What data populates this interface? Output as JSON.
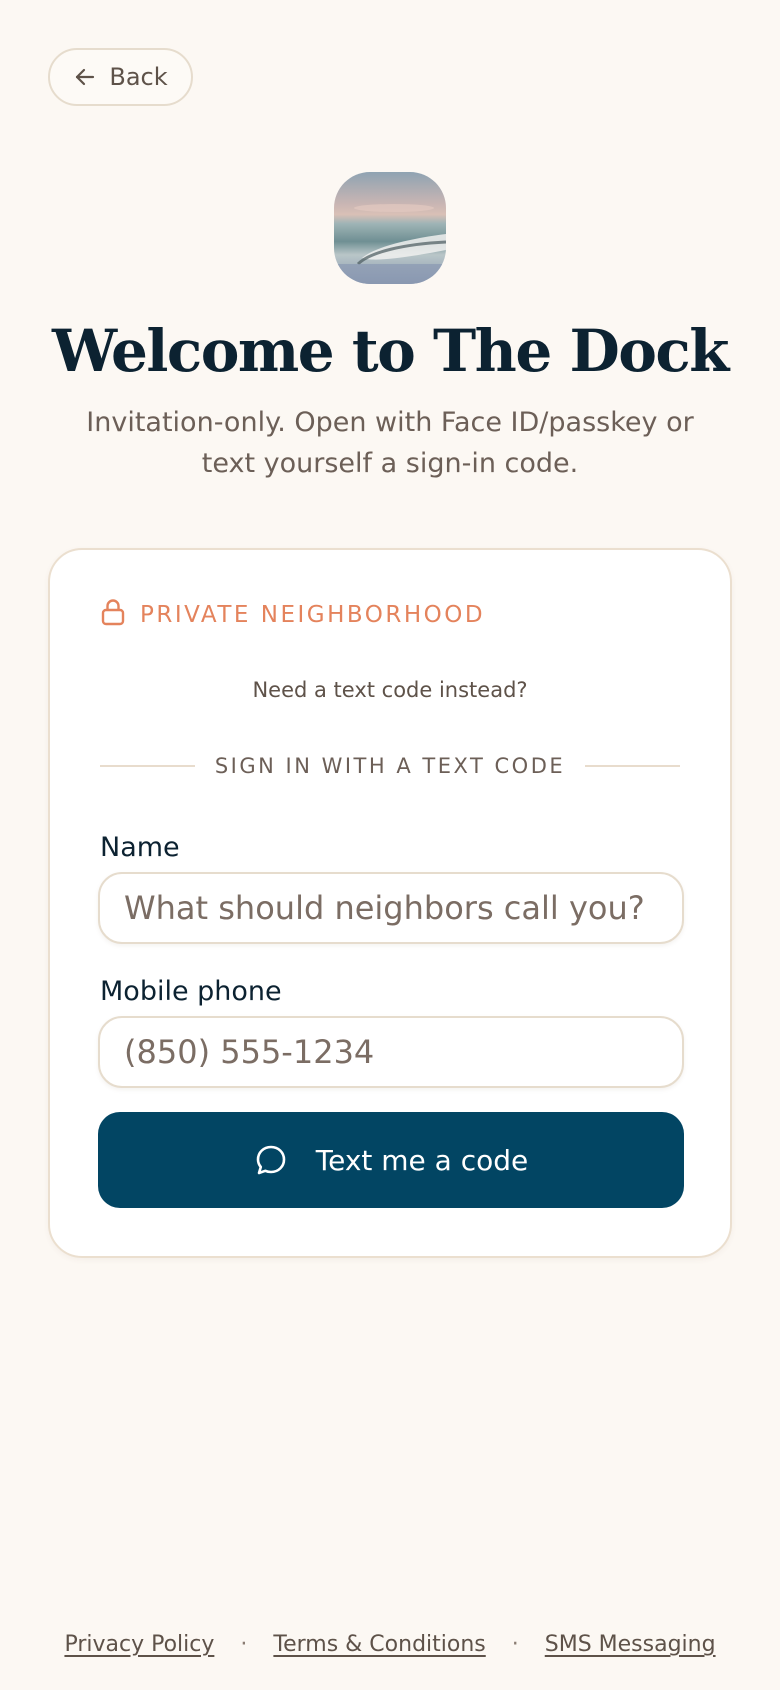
{
  "header": {
    "back_label": "Back",
    "back_icon": "arrow-left-icon"
  },
  "hero": {
    "image": "beach-shoreline-app-icon"
  },
  "title": "Welcome to The Dock",
  "subtitle": "Invitation-only. Open with Face ID/passkey or text yourself a sign-in code.",
  "card": {
    "badge_icon": "lock-icon",
    "badge_text": "PRIVATE NEIGHBORHOOD",
    "alt_link": "Need a text code instead?",
    "divider_text": "SIGN IN WITH A TEXT CODE",
    "name": {
      "label": "Name",
      "placeholder": "What should neighbors call you?",
      "value": ""
    },
    "phone": {
      "label": "Mobile phone",
      "placeholder": "(850) 555-1234",
      "value": ""
    },
    "submit_label": "Text me a code",
    "submit_icon": "chat-bubble-icon"
  },
  "footer": {
    "links": [
      "Privacy Policy",
      "Terms & Conditions",
      "SMS Messaging"
    ],
    "separator": "·"
  },
  "colors": {
    "background": "#fcf8f3",
    "accent": "#e4835c",
    "primary": "#024563",
    "text": "#0c2231",
    "muted": "#6c5f57"
  }
}
